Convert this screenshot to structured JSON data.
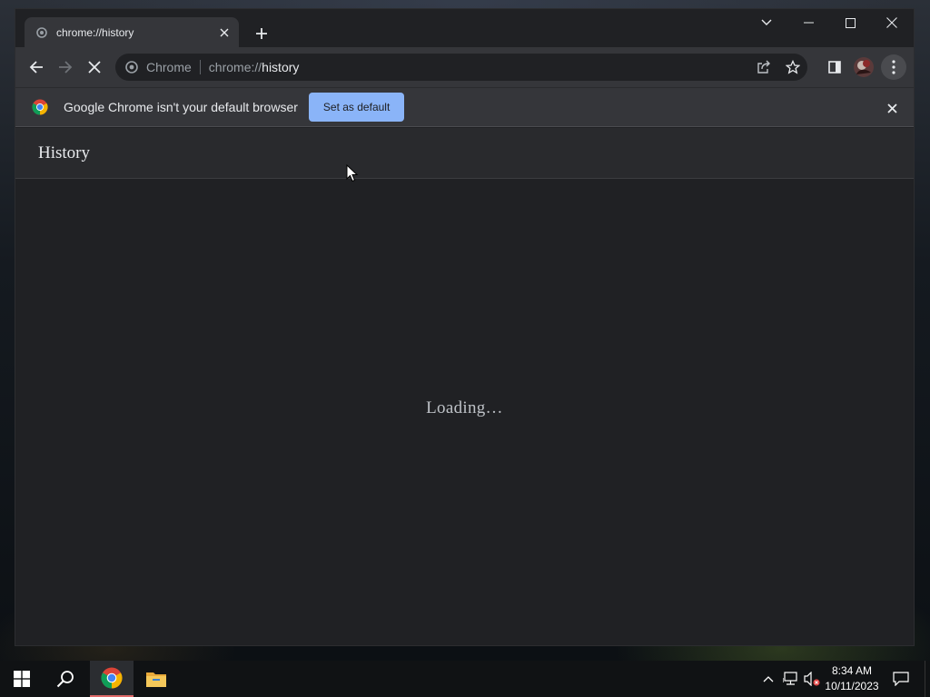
{
  "browser": {
    "tab": {
      "title": "chrome://history",
      "favicon": "chrome-page-icon"
    },
    "new_tab_icon": "plus-icon",
    "window_controls": [
      "tab-search-icon",
      "minimize-icon",
      "maximize-icon",
      "close-icon"
    ],
    "toolbar": {
      "back_icon": "back-arrow-icon",
      "forward_icon": "forward-arrow-icon",
      "stop_icon": "stop-loading-icon",
      "omnibox": {
        "chip_label": "Chrome",
        "url_scheme": "chrome://",
        "url_path": "history"
      },
      "actions": [
        "share-icon",
        "bookmark-star-icon",
        "side-panel-icon",
        "profile-avatar",
        "menu-kebab-icon"
      ]
    },
    "infobar": {
      "message": "Google Chrome isn't your default browser",
      "button_label": "Set as default",
      "button_color": "#8ab4f8"
    },
    "page": {
      "title": "History",
      "status": "Loading…"
    }
  },
  "taskbar": {
    "items": [
      "windows-start-icon",
      "search-icon",
      "chrome-icon",
      "file-explorer-icon"
    ],
    "active_item": "chrome-icon",
    "tray": [
      "chevron-up-icon",
      "network-icon",
      "volume-muted-icon"
    ],
    "time": "8:34 AM",
    "date": "10/11/2023"
  },
  "colors": {
    "window_bg": "#202124",
    "toolbar_bg": "#35363a",
    "accent": "#8ab4f8",
    "text": "#e8eaed"
  }
}
